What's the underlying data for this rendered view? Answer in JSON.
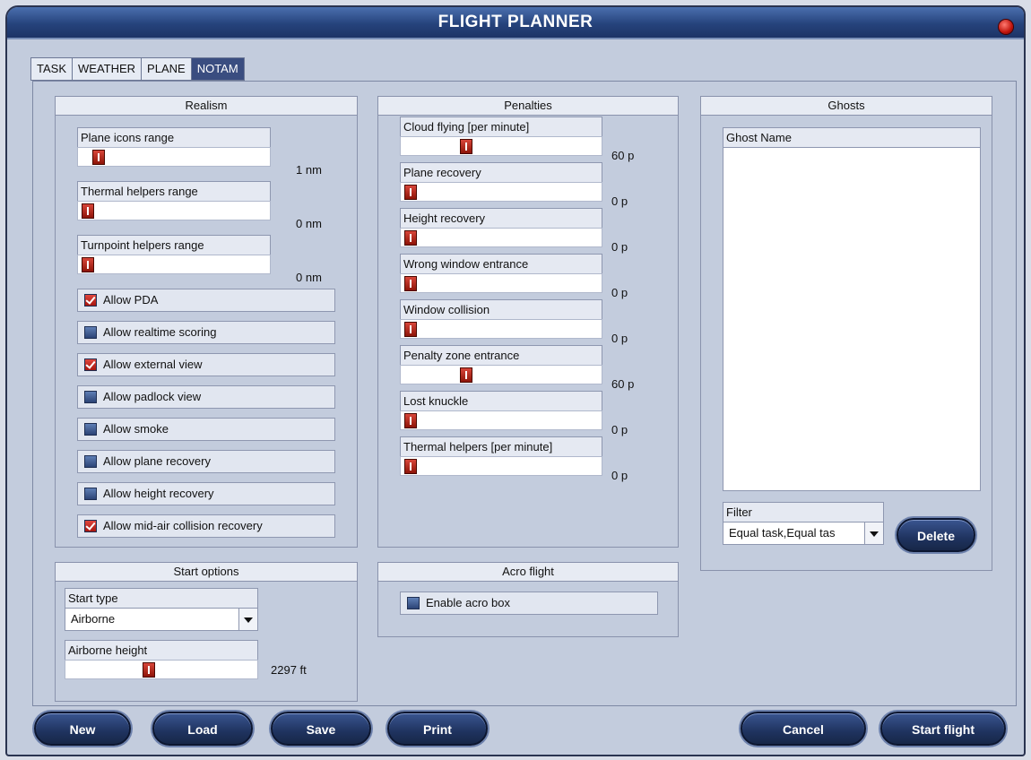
{
  "window": {
    "title": "FLIGHT PLANNER"
  },
  "tabs": [
    "TASK",
    "WEATHER",
    "PLANE",
    "NOTAM"
  ],
  "active_tab": "NOTAM",
  "realism": {
    "header": "Realism",
    "sliders": [
      {
        "label": "Plane icons range",
        "value_text": "1 nm",
        "fraction": 0.06
      },
      {
        "label": "Thermal helpers range",
        "value_text": "0 nm",
        "fraction": 0.0
      },
      {
        "label": "Turnpoint helpers range",
        "value_text": "0 nm",
        "fraction": 0.0
      }
    ],
    "checkboxes": [
      {
        "label": "Allow PDA",
        "checked": true
      },
      {
        "label": "Allow realtime scoring",
        "checked": false
      },
      {
        "label": "Allow external view",
        "checked": true
      },
      {
        "label": "Allow padlock view",
        "checked": false
      },
      {
        "label": "Allow smoke",
        "checked": false
      },
      {
        "label": "Allow plane recovery",
        "checked": false
      },
      {
        "label": "Allow height recovery",
        "checked": false
      },
      {
        "label": "Allow mid-air collision recovery",
        "checked": true
      }
    ]
  },
  "penalties": {
    "header": "Penalties",
    "sliders": [
      {
        "label": "Cloud flying [per minute]",
        "value_text": "60 p",
        "fraction": 0.3
      },
      {
        "label": "Plane recovery",
        "value_text": "0 p",
        "fraction": 0.0
      },
      {
        "label": "Height recovery",
        "value_text": "0 p",
        "fraction": 0.0
      },
      {
        "label": "Wrong window entrance",
        "value_text": "0 p",
        "fraction": 0.0
      },
      {
        "label": "Window collision",
        "value_text": "0 p",
        "fraction": 0.0
      },
      {
        "label": "Penalty zone entrance",
        "value_text": "60 p",
        "fraction": 0.3
      },
      {
        "label": "Lost knuckle",
        "value_text": "0 p",
        "fraction": 0.0
      },
      {
        "label": "Thermal helpers [per minute]",
        "value_text": "0 p",
        "fraction": 0.0
      }
    ]
  },
  "ghosts": {
    "header": "Ghosts",
    "column": "Ghost Name",
    "filter_label": "Filter",
    "filter_value": "Equal task,Equal tas",
    "delete_label": "Delete"
  },
  "start_options": {
    "header": "Start options",
    "start_type_label": "Start type",
    "start_type_value": "Airborne",
    "height_label": "Airborne height",
    "height_value": "2297 ft",
    "height_fraction": 0.42
  },
  "acro": {
    "header": "Acro flight",
    "checkbox_label": "Enable acro box",
    "checked": false
  },
  "buttons": {
    "new": "New",
    "load": "Load",
    "save": "Save",
    "print": "Print",
    "cancel": "Cancel",
    "start": "Start flight"
  }
}
